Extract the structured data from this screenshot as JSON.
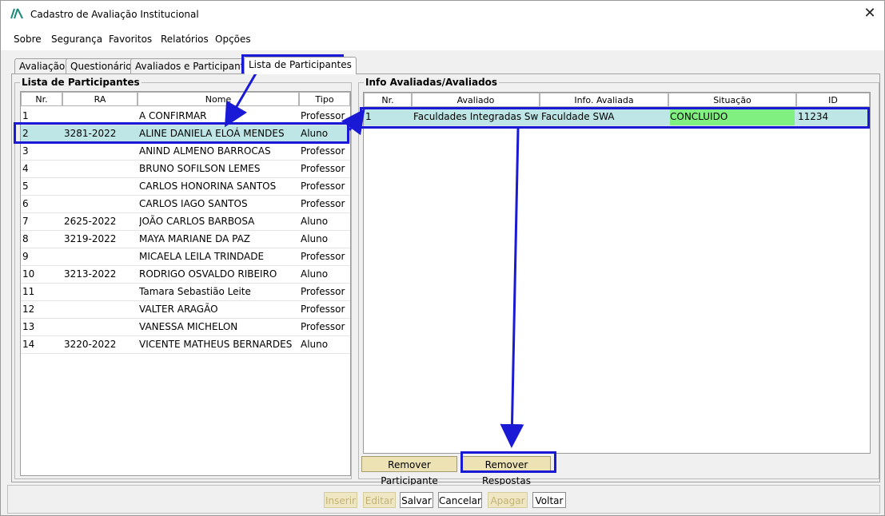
{
  "window": {
    "title": "Cadastro de Avaliação Institucional",
    "close_glyph": "✕"
  },
  "menu": [
    {
      "label": "Sobre"
    },
    {
      "label": "Segurança"
    },
    {
      "label": "Favoritos"
    },
    {
      "label": "Relatórios"
    },
    {
      "label": "Opções"
    }
  ],
  "tabs": [
    {
      "label": "Avaliação"
    },
    {
      "label": "Questionário"
    },
    {
      "label": "Avaliados e Participantes"
    },
    {
      "label": "Lista de Participantes"
    }
  ],
  "participants": {
    "group_label": "Lista de Participantes",
    "columns": [
      "Nr.",
      "RA",
      "Nome",
      "Tipo"
    ],
    "rows": [
      [
        "1",
        "",
        "A CONFIRMAR",
        "Professor"
      ],
      [
        "2",
        "3281-2022",
        "ALINE DANIELA ELOÁ MENDES",
        "Aluno"
      ],
      [
        "3",
        "",
        "ANIND ALMENO BARROCAS",
        "Professor"
      ],
      [
        "4",
        "",
        "BRUNO SOFILSON LEMES",
        "Professor"
      ],
      [
        "5",
        "",
        "CARLOS HONORINA SANTOS",
        "Professor"
      ],
      [
        "6",
        "",
        "CARLOS IAGO SANTOS",
        "Professor"
      ],
      [
        "7",
        "2625-2022",
        "JOÃO CARLOS BARBOSA",
        "Aluno"
      ],
      [
        "8",
        "3219-2022",
        "MAYA MARIANE DA PAZ",
        "Aluno"
      ],
      [
        "9",
        "",
        "MICAELA LEILA TRINDADE",
        "Professor"
      ],
      [
        "10",
        "3213-2022",
        "RODRIGO OSVALDO RIBEIRO",
        "Aluno"
      ],
      [
        "11",
        "",
        "Tamara Sebastião Leite",
        "Professor"
      ],
      [
        "12",
        "",
        "VALTER ARAGÃO",
        "Professor"
      ],
      [
        "13",
        "",
        "VANESSA MICHELON",
        "Professor"
      ],
      [
        "14",
        "3220-2022",
        "VICENTE MATHEUS BERNARDES",
        "Aluno"
      ]
    ]
  },
  "info": {
    "group_label": "Info Avaliadas/Avaliados",
    "columns": [
      "Nr.",
      "Avaliado",
      "Info. Avaliada",
      "Situação",
      "ID"
    ],
    "rows": [
      [
        "1",
        "Faculdades Integradas Swa",
        "Faculdade SWA",
        "CONCLUIDO",
        "11234"
      ]
    ],
    "status_color": "#80f080"
  },
  "panel_buttons": {
    "remove_participant": "Remover Participante",
    "remove_answers": "Remover Respostas"
  },
  "bottom_buttons": {
    "insert": "Inserir",
    "edit": "Editar",
    "save": "Salvar",
    "cancel": "Cancelar",
    "delete": "Apagar",
    "back": "Voltar"
  },
  "colors": {
    "highlight": "#1a1ad6",
    "selected_row": "#bfe6e6",
    "button_tan": "#ece2b4"
  }
}
